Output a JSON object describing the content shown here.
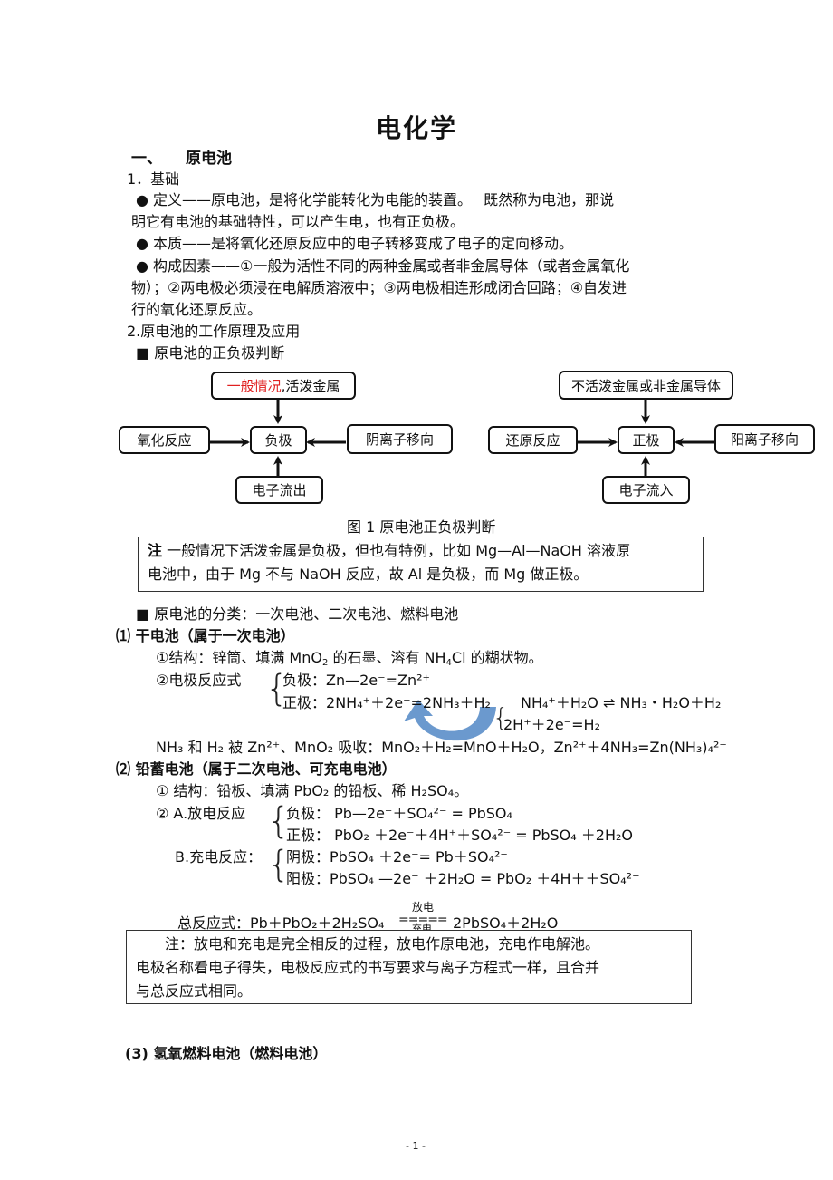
{
  "title": "电化学",
  "section1": {
    "number": "一、",
    "label": "原电池"
  },
  "basics": {
    "heading": "1．基础",
    "definition": [
      "● 定义——原电池，是将化学能转化为电能的装置。　 既然称为电池，那说",
      "明它有电池的基础特性，可以产生电，也有正负极。"
    ],
    "essence": "● 本质——是将氧化还原反应中的电子转移变成了电子的定向移动。",
    "factors": [
      "● 构成因素——①一般为活性不同的两种金属或者非金属导体（或者金属氧化",
      "物）；②两电极必须浸在电解质溶液中；③两电极相连形成闭合回路；④自发进",
      "行的氧化还原反应。"
    ]
  },
  "principle": {
    "heading": "2.原电池的工作原理及应用",
    "judge_heading": "■ 原电池的正负极判断"
  },
  "diagram": {
    "negative": {
      "top_red": "一般情况",
      "top_rest": ",活泼金属",
      "left": "氧化反应",
      "center": "负极",
      "right": "阴离子移向",
      "bottom": "电子流出"
    },
    "positive": {
      "top": "不活泼金属或非金属导体",
      "left": "还原反应",
      "center": "正极",
      "right": "阳离子移向",
      "bottom": "电子流入"
    },
    "caption": "图 1  原电池正负极判断",
    "accent_red": "#e02020"
  },
  "note1": {
    "label": "注",
    "line1": " 一般情况下活泼金属是负极，但也有特例，比如 Mg—Al—NaOH 溶液原",
    "line2": "电池中，由于 Mg 不与 NaOH 反应，故 Al 是负极，而 Mg 做正极。"
  },
  "classification": "■ 原电池的分类：一次电池、二次电池、燃料电池",
  "dry_cell": {
    "heading": "⑴ 干电池（属于一次电池）",
    "structure_prefix": "①结构：锌筒、填满 MnO",
    "structure_mid": " 的石墨、溶有 NH",
    "structure_suffix": "Cl 的糊状物。",
    "reaction_label": "②电极反应式",
    "neg_label": "负极：",
    "neg_eq": "Zn—2e⁻=Zn²⁺",
    "pos_label": "正极：",
    "pos_eq": "2NH₄⁺＋2e⁻=2NH₃＋H₂",
    "side_eq1": "NH₄⁺＋H₂O ⇌ NH₃・H₂O＋H₂",
    "side_eq2": "2H⁺＋2e⁻=H₂",
    "absorb": "NH₃ 和 H₂ 被 Zn²⁺、MnO₂ 吸收：MnO₂＋H₂=MnO＋H₂O，Zn²⁺＋4NH₃=Zn(NH₃)₄²⁺",
    "arrow_color": "#5b8ec9"
  },
  "lead_cell": {
    "heading": "⑵ 铅蓄电池（属于二次电池、可充电电池）",
    "structure": "① 结构：铅板、填满 PbO₂ 的铅板、稀 H₂SO₄。",
    "discharge_label": "②  A.放电反应",
    "discharge_neg": "负极：  Pb—2e⁻＋SO₄²⁻ = PbSO₄",
    "discharge_pos": "正极：  PbO₂ ＋2e⁻＋4H⁺＋SO₄²⁻ = PbSO₄ ＋2H₂O",
    "charge_label": "B.充电反应：",
    "charge_cathode": "阴极：PbSO₄ ＋2e⁻= Pb＋SO₄²⁻",
    "charge_anode": "阳极：PbSO₄ —2e⁻ ＋2H₂O = PbO₂ ＋4H＋＋SO₄²⁻",
    "total_label": "总反应式：Pb＋PbO₂＋2H₂SO₄",
    "total_arrow_top": "放电",
    "total_arrow_bottom": "充电",
    "total_product": "2PbSO₄＋2H₂O"
  },
  "note2": {
    "line1": "　　注：放电和充电是完全相反的过程，放电作原电池，充电作电解池。",
    "line2": "电极名称看电子得失，电极反应式的书写要求与离子方程式一样，且合并",
    "line3": "与总反应式相同。"
  },
  "fuel_cell": {
    "heading": "(3)  氢氧燃料电池（燃料电池）"
  },
  "page_number": "- 1 -"
}
